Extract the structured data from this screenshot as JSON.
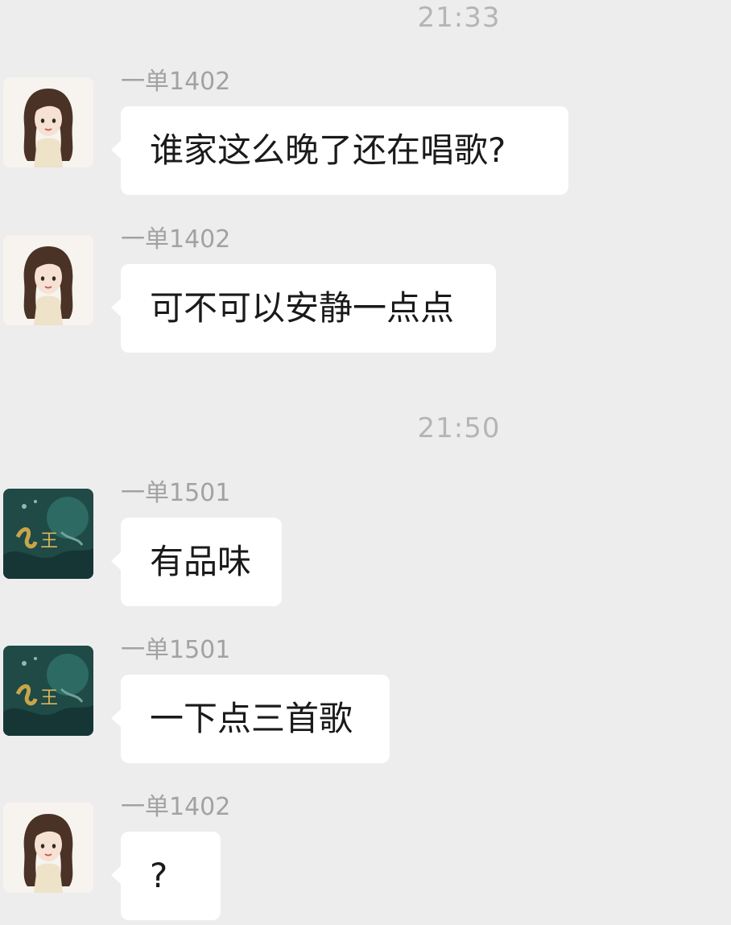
{
  "timestamps": [
    "21:33",
    "21:50"
  ],
  "messages": [
    {
      "sender": "一单1402",
      "text": "谁家这么晚了还在唱歌?",
      "avatar": "girl-avatar"
    },
    {
      "sender": "一单1402",
      "text": "可不可以安静一点点",
      "avatar": "girl-avatar"
    },
    {
      "sender": "一单1501",
      "text": "有品味",
      "avatar": "teal-artwork-avatar"
    },
    {
      "sender": "一单1501",
      "text": "一下点三首歌",
      "avatar": "teal-artwork-avatar"
    },
    {
      "sender": "一单1402",
      "text": "?",
      "avatar": "girl-avatar"
    }
  ],
  "colors": {
    "background": "#ededed",
    "bubble": "#ffffff",
    "sender_text": "#a2a2a2",
    "timestamp_text": "#b5b5b5"
  }
}
